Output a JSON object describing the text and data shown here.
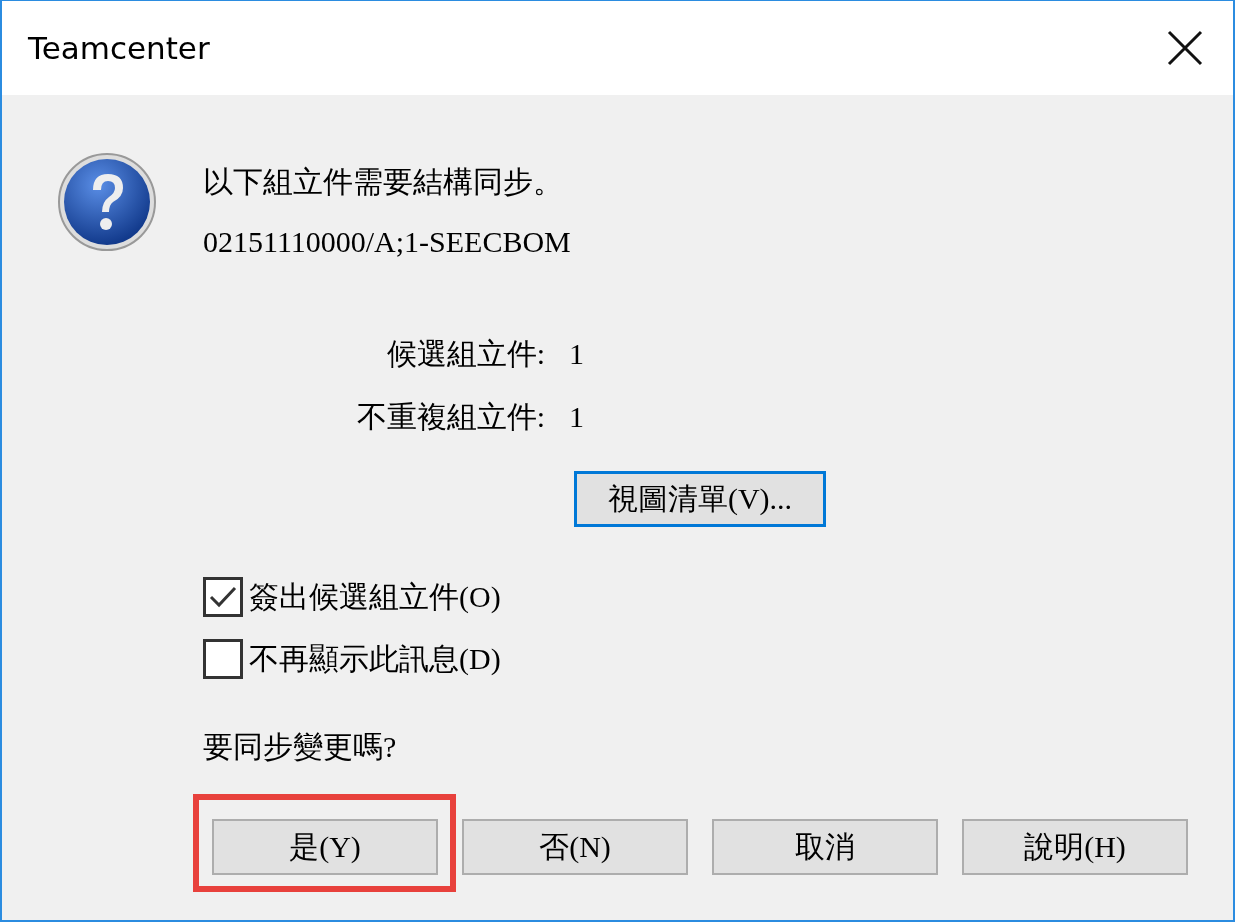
{
  "window": {
    "title": "Teamcenter"
  },
  "message": [
    "以下組立件需要結構同步。",
    "02151110000/A;1-SEECBOM"
  ],
  "counts": [
    {
      "label": "候選組立件:",
      "value": "1"
    },
    {
      "label": "不重複組立件:",
      "value": "1"
    }
  ],
  "view_button": {
    "label": "視圖清單(V)...",
    "focused": true
  },
  "checkboxes": [
    {
      "label": "簽出候選組立件(O)",
      "checked": true
    },
    {
      "label": "不再顯示此訊息(D)",
      "checked": false
    }
  ],
  "question": "要同步變更嗎?",
  "buttons": [
    {
      "label": "是(Y)",
      "highlighted": true
    },
    {
      "label": "否(N)",
      "highlighted": false
    },
    {
      "label": "取消",
      "highlighted": false
    },
    {
      "label": "說明(H)",
      "highlighted": false
    }
  ]
}
